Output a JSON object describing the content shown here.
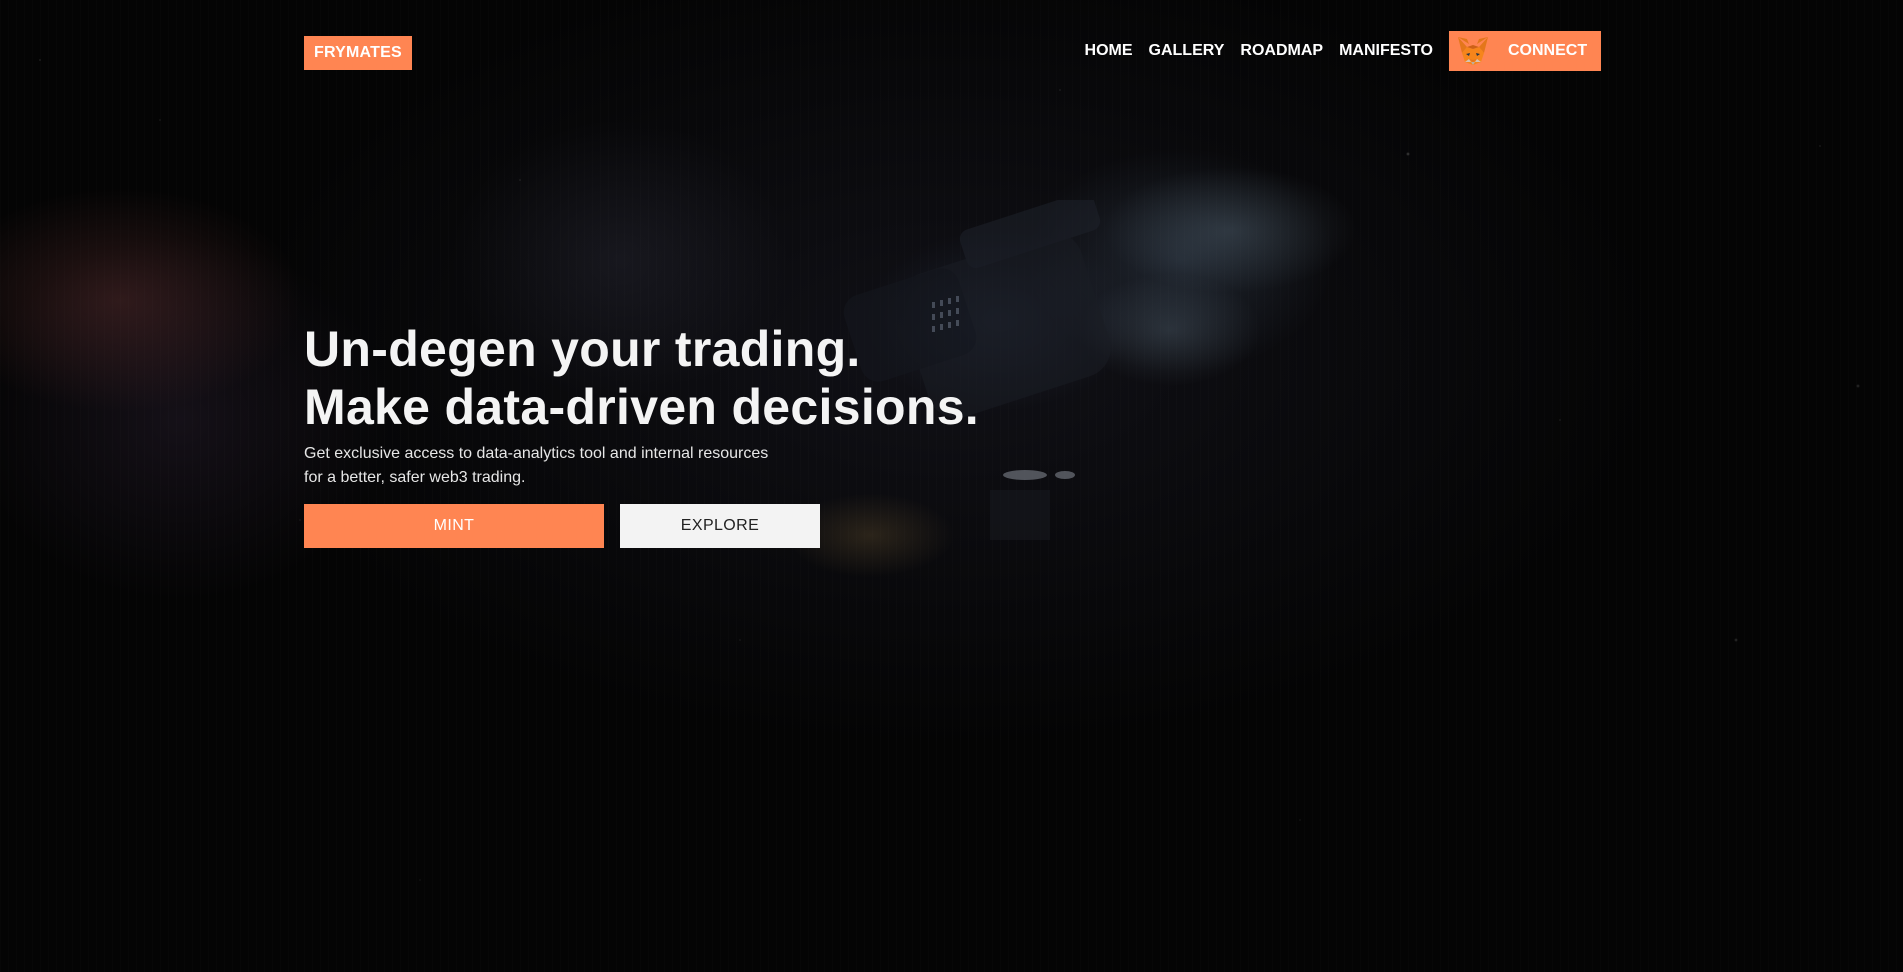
{
  "colors": {
    "accent": "#ff8552",
    "background": "#040404",
    "light_button": "#f3f3f3",
    "text": "#ffffff"
  },
  "nav": {
    "brand": "FRYMATES",
    "links": [
      "HOME",
      "GALLERY",
      "ROADMAP",
      "MANIFESTO"
    ],
    "connect": {
      "label": "CONNECT",
      "icon": "metamask-fox-icon"
    }
  },
  "hero": {
    "headline_line1": "Un-degen your trading.",
    "headline_line2": "Make data-driven decisions.",
    "subtitle_line1": "Get exclusive access to data-analytics tool and internal resources",
    "subtitle_line2": "for a better, safer web3 trading.",
    "primary_button": "MINT",
    "secondary_button": "EXPLORE"
  },
  "background": {
    "icon": "spaceship-illustration"
  }
}
